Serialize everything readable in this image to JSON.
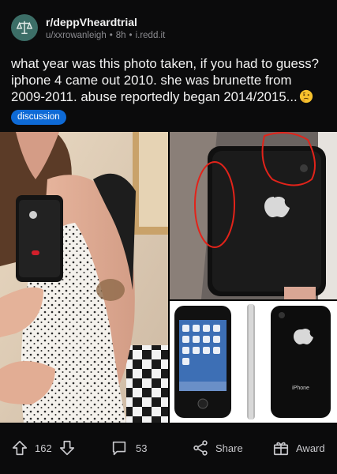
{
  "post": {
    "subreddit": "r/deppVheardtrial",
    "meta": {
      "user": "u/xxrowanleigh",
      "age": "8h",
      "domain": "i.redd.it"
    },
    "title": "what year was this photo taken, if you had to guess? iphone 4 came out 2010. she was brunette from 2009-2011. abuse reportedly began 2014/2015...",
    "emoji": "thinking-face-emoji",
    "flair": "discussion"
  },
  "image": {
    "phone_label": "iPhone"
  },
  "actions": {
    "score": "162",
    "comments": "53",
    "share": "Share",
    "award": "Award"
  },
  "colors": {
    "background": "#0b0b0c",
    "flair": "#0e6ad6",
    "avatar": "#3c6e67",
    "circle_annotation": "#e2231a"
  }
}
